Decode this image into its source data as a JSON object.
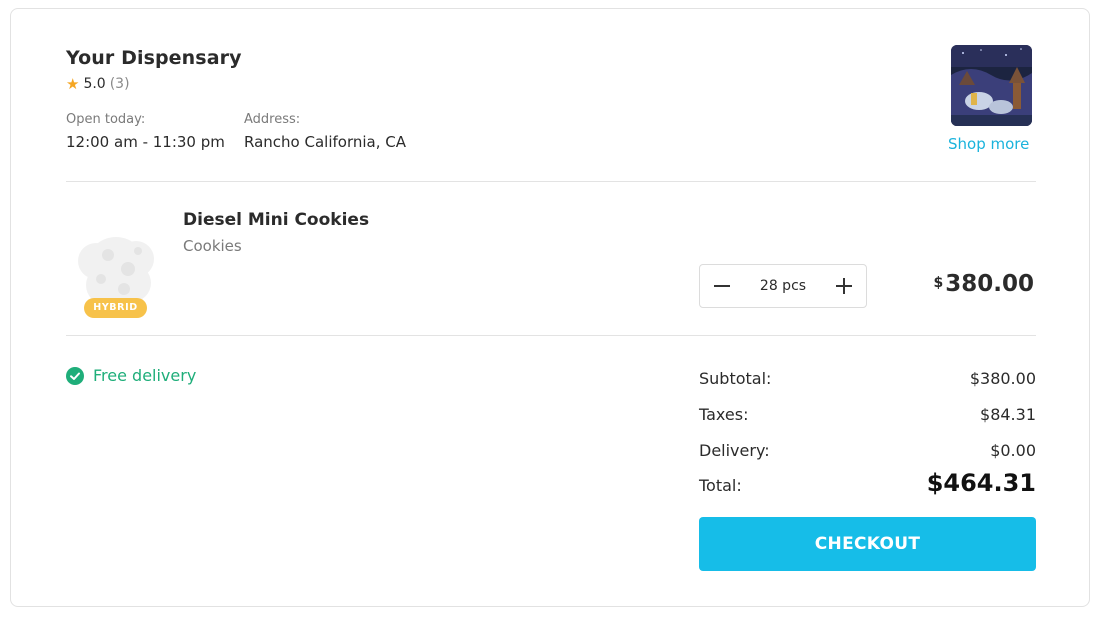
{
  "store": {
    "name": "Your Dispensary",
    "rating": "5.0",
    "rating_count": "(3)",
    "open_label": "Open today:",
    "open_hours": "12:00 am - 11:30 pm",
    "address_label": "Address:",
    "address": "Rancho California, CA",
    "shop_more_label": "Shop more"
  },
  "item": {
    "name": "Diesel Mini Cookies",
    "category": "Cookies",
    "strain": "HYBRID",
    "quantity": "28 pcs",
    "price_currency": "$",
    "price_amount": "380.00"
  },
  "delivery": {
    "label": "Free delivery"
  },
  "summary": {
    "subtotal_label": "Subtotal:",
    "subtotal_value": "$380.00",
    "taxes_label": "Taxes:",
    "taxes_value": "$84.31",
    "delivery_label": "Delivery:",
    "delivery_value": "$0.00",
    "total_label": "Total:",
    "total_value": "$464.31"
  },
  "checkout_label": "CHECKOUT",
  "colors": {
    "accent": "#16bde8",
    "link": "#1ab3dc",
    "success": "#1fae7a",
    "badge": "#f7c24a",
    "star": "#f5a623"
  },
  "icons": [
    "star-icon",
    "minus-icon",
    "plus-icon",
    "check-circle-icon"
  ]
}
